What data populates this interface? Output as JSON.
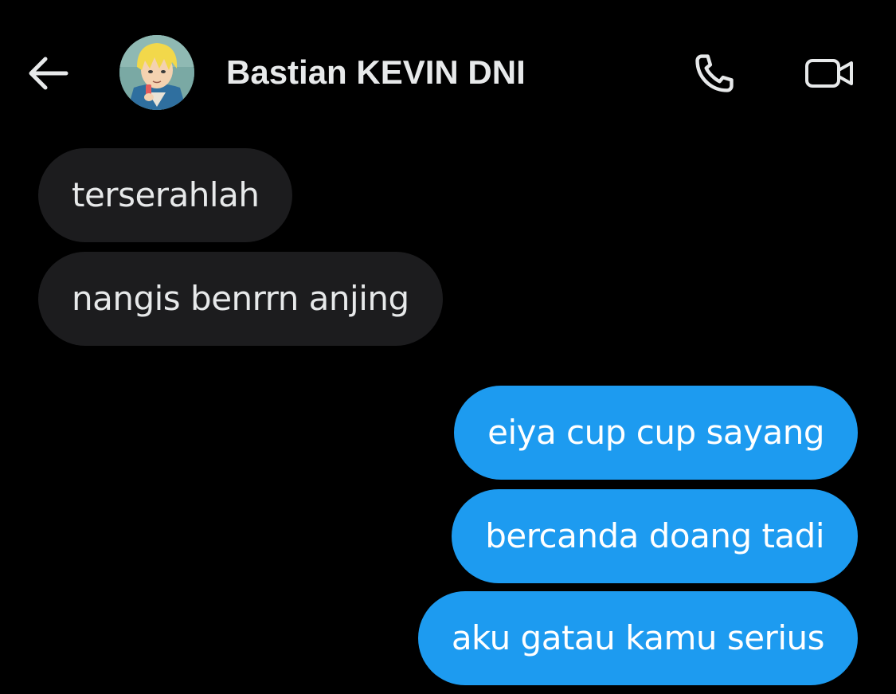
{
  "header": {
    "back_icon": "arrow-left-icon",
    "contact_name": "Bastian KEVIN DNI",
    "call_icon": "phone-icon",
    "video_icon": "video-camera-icon"
  },
  "colors": {
    "background": "#000000",
    "received_bubble": "#1c1c1e",
    "sent_bubble": "#1d9bf0",
    "text": "#e7e9ea"
  },
  "messages": [
    {
      "direction": "received",
      "text": "terserahlah"
    },
    {
      "direction": "received",
      "text": "nangis benrrn anjing"
    },
    {
      "direction": "sent",
      "text": "eiya cup cup sayang"
    },
    {
      "direction": "sent",
      "text": "bercanda doang tadi"
    },
    {
      "direction": "sent",
      "text": "aku gatau kamu serius"
    }
  ]
}
